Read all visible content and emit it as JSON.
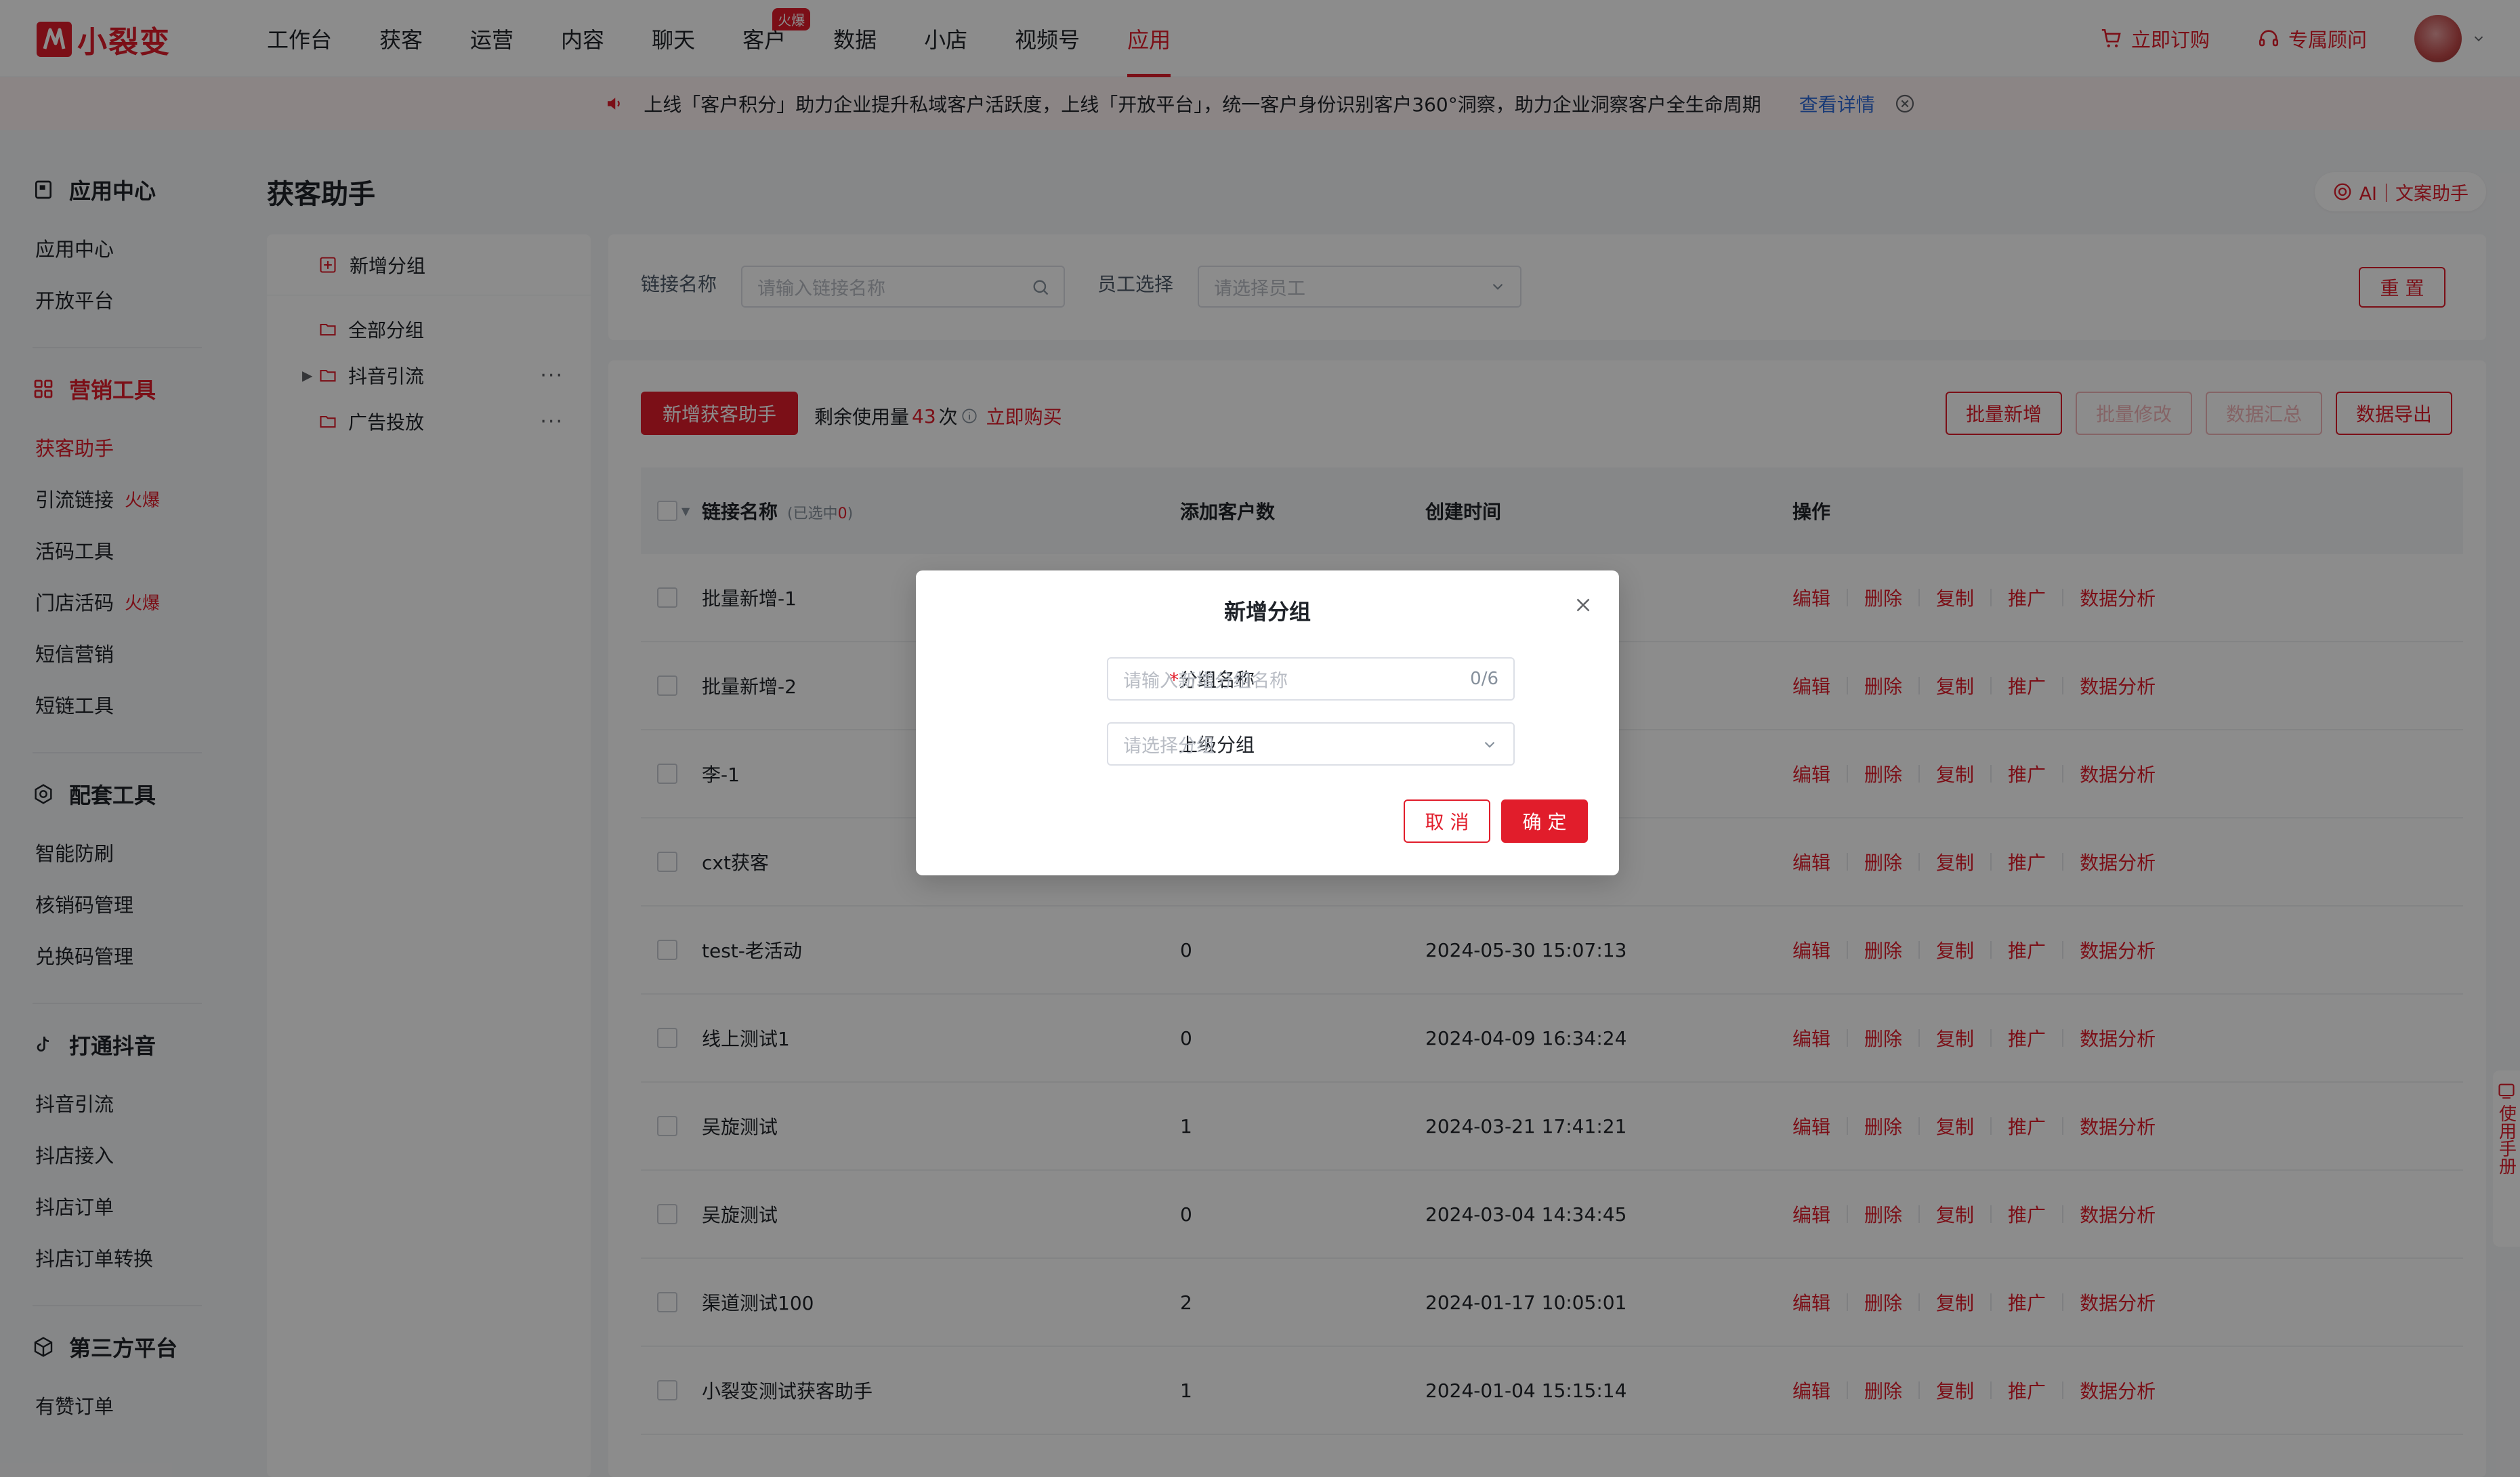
{
  "brand": {
    "name": "小裂变",
    "color": "#e11d2b"
  },
  "nav": {
    "items": [
      {
        "label": "工作台"
      },
      {
        "label": "获客"
      },
      {
        "label": "运营"
      },
      {
        "label": "内容"
      },
      {
        "label": "聊天"
      },
      {
        "label": "客户",
        "badge": "火爆"
      },
      {
        "label": "数据"
      },
      {
        "label": "小店"
      },
      {
        "label": "视频号"
      },
      {
        "label": "应用",
        "active": true
      }
    ],
    "order_label": "立即订购",
    "consultant_label": "专属顾问"
  },
  "notice": {
    "text": "上线「客户积分」助力企业提升私域客户活跃度，上线「开放平台」，统一客户身份识别客户360°洞察，助力企业洞察客户全生命周期",
    "link": "查看详情"
  },
  "sidebar": {
    "groups": [
      {
        "title": "应用中心",
        "icon": "app-icon",
        "items": [
          {
            "label": "应用中心"
          },
          {
            "label": "开放平台"
          }
        ]
      },
      {
        "title": "营销工具",
        "icon": "grid-icon",
        "items": [
          {
            "label": "获客助手",
            "active": true
          },
          {
            "label": "引流链接",
            "hot": "火爆"
          },
          {
            "label": "活码工具"
          },
          {
            "label": "门店活码",
            "hot": "火爆"
          },
          {
            "label": "短信营销"
          },
          {
            "label": "短链工具"
          }
        ]
      },
      {
        "title": "配套工具",
        "icon": "settings-icon",
        "items": [
          {
            "label": "智能防刷"
          },
          {
            "label": "核销码管理"
          },
          {
            "label": "兑换码管理"
          }
        ]
      },
      {
        "title": "打通抖音",
        "icon": "tiktok-icon",
        "items": [
          {
            "label": "抖音引流"
          },
          {
            "label": "抖店接入"
          },
          {
            "label": "抖店订单"
          },
          {
            "label": "抖店订单转换"
          }
        ]
      },
      {
        "title": "第三方平台",
        "icon": "cube-icon",
        "items": [
          {
            "label": "有赞订单"
          }
        ]
      }
    ]
  },
  "page": {
    "title": "获客助手",
    "ai_button": "AI｜文案助手"
  },
  "groups_panel": {
    "add_label": "新增分组",
    "items": [
      {
        "label": "全部分组",
        "expandable": false,
        "more": false
      },
      {
        "label": "抖音引流",
        "expandable": true,
        "more": true
      },
      {
        "label": "广告投放",
        "expandable": false,
        "more": true
      }
    ]
  },
  "filters": {
    "link_name_label": "链接名称",
    "link_name_placeholder": "请输入链接名称",
    "employee_label": "员工选择",
    "employee_placeholder": "请选择员工",
    "reset_label": "重 置"
  },
  "toolbar": {
    "add_label": "新增获客助手",
    "remain_prefix": "剩余使用量",
    "remain_count": "43",
    "remain_suffix": "次",
    "buy_label": "立即购买",
    "batch_add": "批量新增",
    "batch_edit": "批量修改",
    "data_summary": "数据汇总",
    "data_export": "数据导出"
  },
  "table": {
    "headers": {
      "name": "链接名称",
      "selected_prefix": "(已选中",
      "selected_count": "0",
      "selected_suffix": ")",
      "count": "添加客户数",
      "time": "创建时间",
      "ops": "操作"
    },
    "ops": [
      "编辑",
      "删除",
      "复制",
      "推广",
      "数据分析"
    ],
    "rows": [
      {
        "name": "批量新增-1",
        "count": "",
        "time": ""
      },
      {
        "name": "批量新增-2",
        "count": "",
        "time": ""
      },
      {
        "name": "李-1",
        "count": "",
        "time": ""
      },
      {
        "name": "cxt获客",
        "count": "",
        "time": ""
      },
      {
        "name": "test-老活动",
        "count": "0",
        "time": "2024-05-30 15:07:13"
      },
      {
        "name": "线上测试1",
        "count": "0",
        "time": "2024-04-09 16:34:24"
      },
      {
        "name": "吴旋测试",
        "count": "1",
        "time": "2024-03-21 17:41:21"
      },
      {
        "name": "吴旋测试",
        "count": "0",
        "time": "2024-03-04 14:34:45"
      },
      {
        "name": "渠道测试100",
        "count": "2",
        "time": "2024-01-17 10:05:01"
      },
      {
        "name": "小裂变测试获客助手",
        "count": "1",
        "time": "2024-01-04 15:15:14"
      }
    ]
  },
  "modal": {
    "title": "新增分组",
    "name_label": "分组名称",
    "required_mark": "*",
    "name_placeholder": "请输入新增分组名称",
    "name_counter": "0/6",
    "parent_label": "上级分组",
    "parent_placeholder": "请选择分组",
    "cancel_label": "取 消",
    "ok_label": "确 定"
  },
  "float_help": {
    "text": "使用手册"
  }
}
